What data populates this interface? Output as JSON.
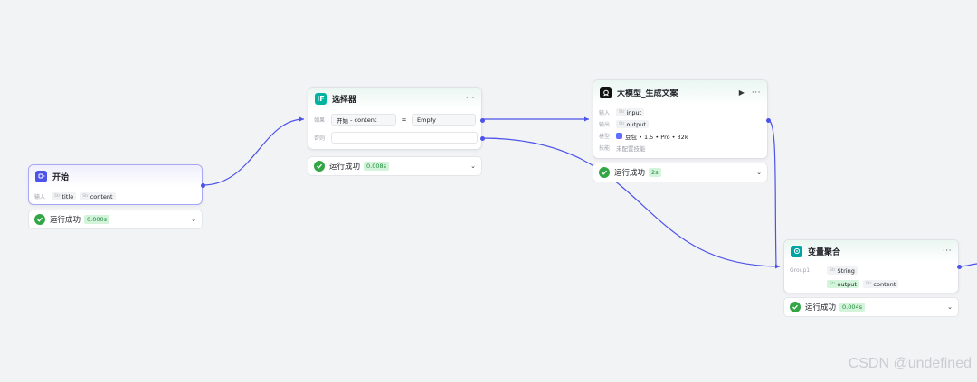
{
  "nodes": {
    "start": {
      "title": "开始",
      "input_label": "输入",
      "inputs": [
        {
          "type": "Str",
          "name": "title"
        },
        {
          "type": "Str",
          "name": "content"
        }
      ],
      "status": {
        "text": "运行成功",
        "time": "0.000s"
      }
    },
    "selector": {
      "title": "选择器",
      "if_label": "如果",
      "else_label": "否则",
      "condition": {
        "left_source": "开始",
        "sep": "-",
        "left_var": "content",
        "operator": "=",
        "right": "Empty"
      },
      "status": {
        "text": "运行成功",
        "time": "0.008s"
      }
    },
    "llm": {
      "title": "大模型_生成文案",
      "input_label": "输入",
      "output_label": "输出",
      "model_label": "模型",
      "skill_label": "技能",
      "input_var": {
        "type": "Str",
        "name": "input"
      },
      "output_var": {
        "type": "Str",
        "name": "output"
      },
      "model_name": "豆包 • 1.5 • Pro • 32k",
      "skill_value": "未配置技能",
      "status": {
        "text": "运行成功",
        "time": "2s"
      }
    },
    "aggregator": {
      "title": "变量聚合",
      "group_label": "Group1",
      "group_type": {
        "type": "Str",
        "name": "String"
      },
      "vars": [
        {
          "type": "Str",
          "name": "output"
        },
        {
          "type": "Str",
          "name": "content"
        }
      ],
      "status": {
        "text": "运行成功",
        "time": "0.004s"
      }
    }
  },
  "icons": {
    "more": "more-icon",
    "play": "play-icon",
    "chevron": "chevron-down-icon",
    "check": "check-circle-icon"
  },
  "colors": {
    "edge": "#4d53e8",
    "start_icon": "#4d53e8",
    "selector_icon": "#00b2a0",
    "llm_icon": "#111111",
    "aggregator_icon": "#00a3a3",
    "success": "#32a645"
  },
  "watermark": "CSDN @undefined"
}
